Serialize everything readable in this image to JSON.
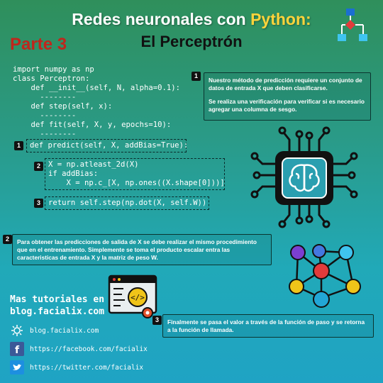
{
  "header": {
    "title_part1": "Redes neuronales con ",
    "title_python": "Python:",
    "part_label": "Parte 3",
    "subtitle": "El Perceptrón"
  },
  "code": {
    "top_lines": "import numpy as np\nclass Perceptron:\n    def __init__(self, N, alpha=0.1):\n      --------\n    def step(self, x):\n      --------\n    def fit(self, X, y, epochs=10):\n      --------",
    "predict_line": "def predict(self, X, addBias=True):",
    "block2": "X = np.atleast_2d(X)\nif addBias:\n    X = np.c_[X, np.ones((X.shape[0]))]",
    "block3": "return self.step(np.dot(X, self.W))"
  },
  "markers": {
    "m1": "1",
    "m2": "2",
    "m3": "3"
  },
  "notes": {
    "note1_p1": "Nuestro método de predicción requiere un conjunto de datos de entrada X que deben clasificarse.",
    "note1_p2": "Se realiza una verificación para verificar si es necesario agregar una columna de sesgo.",
    "note2": "Para obtener las predicciones de salida de X se debe realizar el mismo procedimiento que en el entrenamiento. Simplemente se toma el producto escalar entra las caracteristicas de entrada X y la matriz de peso W.",
    "note3": "Finalmente se pasa el valor a través de la función de paso y se retorna a la función de llamada."
  },
  "footer": {
    "mas_line1": "Mas tutoriales en",
    "mas_line2": "blog.facialix.com",
    "links": {
      "blog": "blog.facialix.com",
      "facebook": "https://facebook.com/facialix",
      "twitter": "https://twitter.com/facialix"
    }
  },
  "icons": [
    "flowchart-icon",
    "brain-chip-icon",
    "network-graph-icon",
    "code-window-icon",
    "web-icon",
    "facebook-icon",
    "twitter-icon"
  ],
  "colors": {
    "python_yellow": "#ffd43b",
    "parte_red": "#c0261c",
    "node_colors": [
      "#7b3fd1",
      "#4478e0",
      "#e23b3b",
      "#f0c419",
      "#22a6d6"
    ]
  }
}
